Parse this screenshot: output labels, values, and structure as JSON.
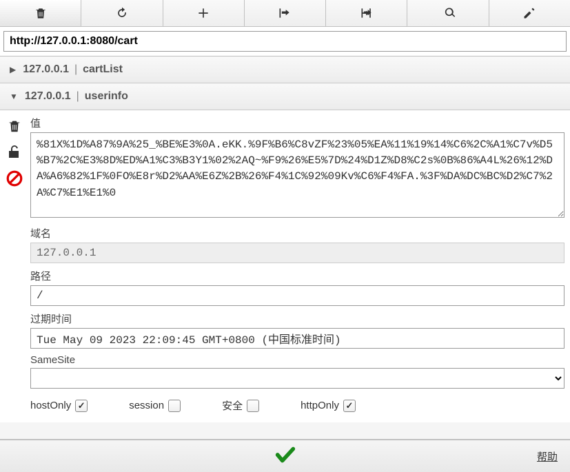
{
  "url": "http://127.0.0.1:8080/cart",
  "cookies": [
    {
      "host": "127.0.0.1",
      "name": "cartList",
      "expanded": false
    },
    {
      "host": "127.0.0.1",
      "name": "userinfo",
      "expanded": true
    }
  ],
  "detail": {
    "value_label": "值",
    "value": "%81X%1D%A87%9A%25_%BE%E3%0A.eKK.%9F%B6%C8vZF%23%05%EA%11%19%14%C6%2C%A1%C7v%D5%B7%2C%E3%8D%ED%A1%C3%B3Y1%02%2AQ~%F9%26%E5%7D%24%D1Z%D8%C2s%0B%86%A4L%26%12%DA%A6%82%1F%0FO%E8r%D2%AA%E6Z%2B%26%F4%1C%92%09Kv%C6%F4%FA.%3F%DA%DC%BC%D2%C7%2A%C7%E1%E1%0",
    "domain_label": "域名",
    "domain": "127.0.0.1",
    "path_label": "路径",
    "path": "/",
    "expires_label": "过期时间",
    "expires": "Tue May 09 2023 22:09:45 GMT+0800 (中国标准时间)",
    "samesite_label": "SameSite",
    "samesite": "",
    "hostOnly_label": "hostOnly",
    "hostOnly": true,
    "session_label": "session",
    "session": false,
    "secure_label": "安全",
    "secure": false,
    "httpOnly_label": "httpOnly",
    "httpOnly": true
  },
  "footer": {
    "help": "帮助"
  }
}
